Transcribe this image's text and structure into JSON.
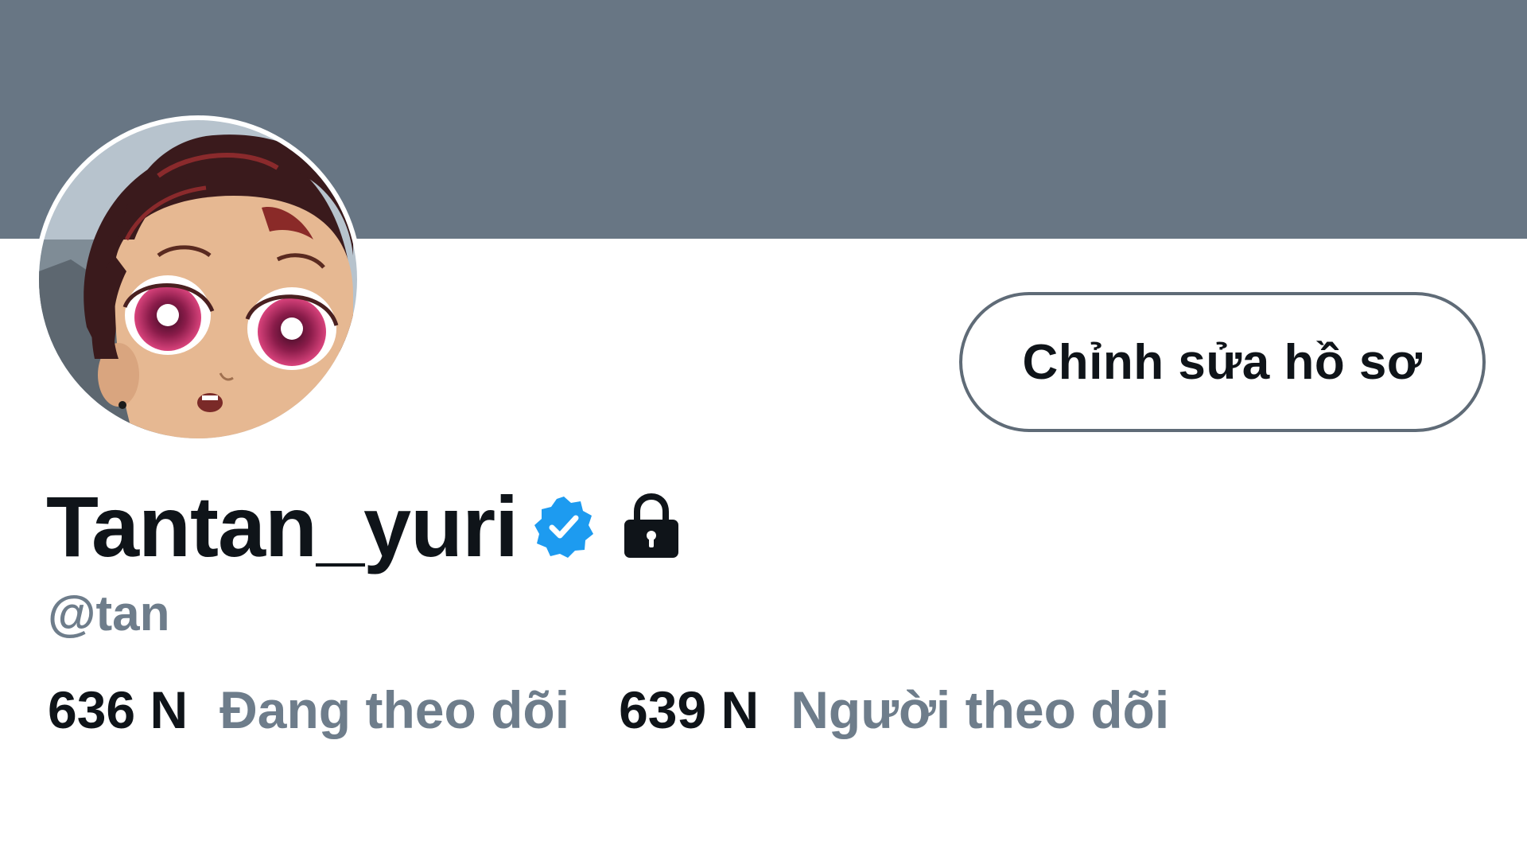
{
  "profile": {
    "display_name": "Tantan_yuri",
    "handle": "@tan",
    "verified_icon": "verified-badge-icon",
    "lock_icon": "lock-icon",
    "avatar": "anime-character-avatar"
  },
  "actions": {
    "edit_profile_label": "Chỉnh sửa hồ sơ"
  },
  "stats": {
    "following_count": "636 N",
    "following_label": "Đang theo dõi",
    "followers_count": "639 N",
    "followers_label": "Người theo dõi"
  },
  "colors": {
    "banner": "#687684",
    "text_primary": "#0f1419",
    "text_secondary": "#6e7d8b",
    "verified_blue": "#1d9bf0"
  }
}
